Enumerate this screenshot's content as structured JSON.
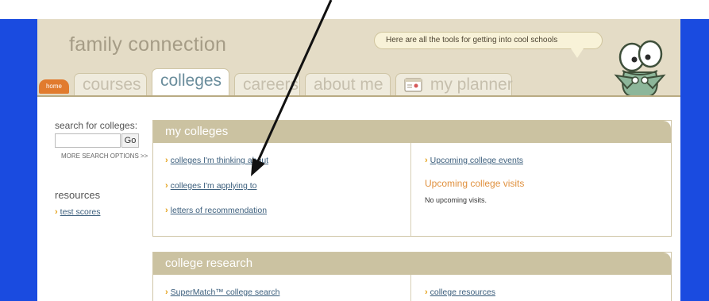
{
  "header": {
    "brand": "family connection",
    "bubble_text": "Here are all the tools for getting into cool schools"
  },
  "tabs": {
    "home": "home",
    "courses": "courses",
    "colleges": "colleges",
    "careers": "careers",
    "about_me": "about me",
    "my_planner": "my planner"
  },
  "sidebar": {
    "search_label": "search for colleges:",
    "search_value": "",
    "go_label": "Go",
    "more_options": "MORE SEARCH OPTIONS >>",
    "resources_label": "resources",
    "test_scores": "test scores"
  },
  "my_colleges": {
    "title": "my colleges",
    "thinking_about": "colleges I'm thinking about",
    "applying_to": "colleges I'm applying to",
    "letters": "letters of recommendation",
    "upcoming_events": "Upcoming college events",
    "visits_title": "Upcoming college visits",
    "no_visits": "No upcoming visits."
  },
  "college_research": {
    "title": "college research",
    "supermatch": "SuperMatch™ college search",
    "resources": "college resources"
  },
  "colors": {
    "frame_blue": "#1a4be0",
    "header_beige": "#e4dcc6",
    "panel_head": "#cbc2a1",
    "home_orange": "#e17b2e",
    "link_blue": "#3b5e7c",
    "accent_orange": "#e0913f"
  }
}
